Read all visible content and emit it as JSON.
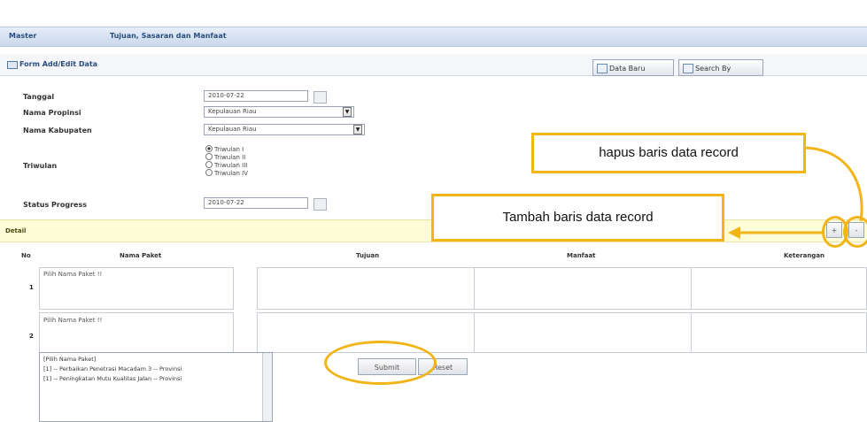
{
  "header": {
    "section": "Master",
    "title": "Tujuan, Sasaran dan Manfaat"
  },
  "form": {
    "title": "Form Add/Edit Data",
    "btn_new": "Data Baru",
    "btn_search": "Search By",
    "tanggal_label": "Tanggal",
    "tanggal_value": "2010-07-22",
    "propinsi_label": "Nama Propinsi",
    "propinsi_value": "Kepulauan Riau",
    "kabupaten_label": "Nama Kabupaten",
    "kabupaten_value": "Kepulauan Riau",
    "triwulan_label": "Triwulan",
    "triwulan_options": [
      "Triwulan I",
      "Triwulan II",
      "Triwulan III",
      "Triwulan IV"
    ],
    "triwulan_selected": "Triwulan I",
    "status_label": "Status Progress",
    "status_value": "2010-07-22"
  },
  "detail": {
    "label": "Detail",
    "add_button": "+",
    "remove_button": "-",
    "columns": [
      "No",
      "Nama Paket",
      "Tujuan",
      "Manfaat",
      "Keterangan"
    ],
    "rows": [
      {
        "no": "1",
        "paket": "Pilih Nama Paket !!"
      },
      {
        "no": "2",
        "paket": "Pilih Nama Paket !!"
      }
    ],
    "dropdown_items": [
      "[Pilih Nama Paket]",
      "[1] -- Perbaikan Penetrasi Macadam 3 -- Provinsi",
      "[1] -- Peningkatan Mutu Kualitas Jalan -- Provinsi"
    ]
  },
  "buttons": {
    "submit": "Submit",
    "reset": "Reset"
  },
  "annotations": {
    "hapus": "hapus baris data record",
    "tambah": "Tambah baris data record",
    "color": "#f2b416"
  }
}
